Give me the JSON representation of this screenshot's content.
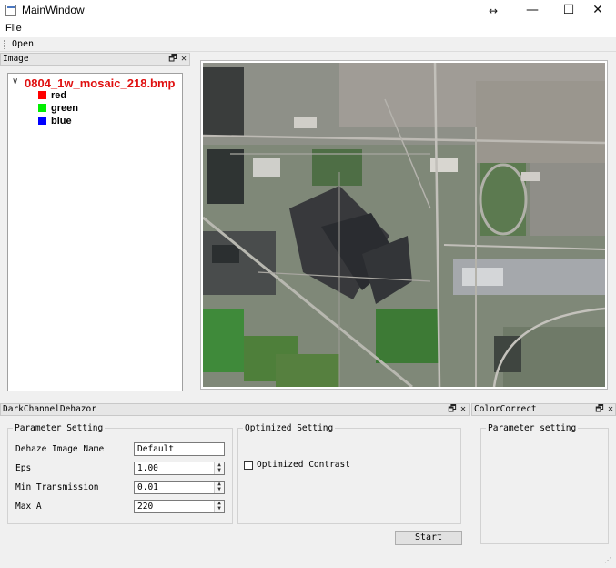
{
  "window": {
    "title": "MainWindow",
    "controls": {
      "resize": "↔",
      "minimize": "—",
      "maximize": "☐",
      "close": "✕"
    }
  },
  "menu": {
    "file_label": "File"
  },
  "toolbar": {
    "open_label": "Open"
  },
  "image_dock": {
    "title": "Image",
    "tree": {
      "root_label": "0804_1w_mosaic_218.bmp",
      "children": [
        {
          "label": "red",
          "color": "#ff0000"
        },
        {
          "label": "green",
          "color": "#00ee00"
        },
        {
          "label": "blue",
          "color": "#0000ff"
        }
      ]
    }
  },
  "dehazor_dock": {
    "title": "DarkChannelDehazor",
    "parameter_group": "Parameter Setting",
    "fields": [
      {
        "label": "Dehaze Image Name",
        "value": "Default"
      },
      {
        "label": "Eps",
        "value": "1.00"
      },
      {
        "label": "Min Transmission",
        "value": "0.01"
      },
      {
        "label": "Max A",
        "value": "220"
      }
    ],
    "optimized_group": "Optimized Setting",
    "optimized_checkbox": {
      "label": "Optimized Contrast",
      "checked": false
    },
    "start_label": "Start"
  },
  "color_dock": {
    "title": "ColorCorrect",
    "parameter_group": "Parameter setting"
  },
  "icons": {
    "float": "🗗",
    "close": "✕",
    "tree_expand": "chevron-down-icon",
    "spin": "spin-arrows-icon"
  }
}
